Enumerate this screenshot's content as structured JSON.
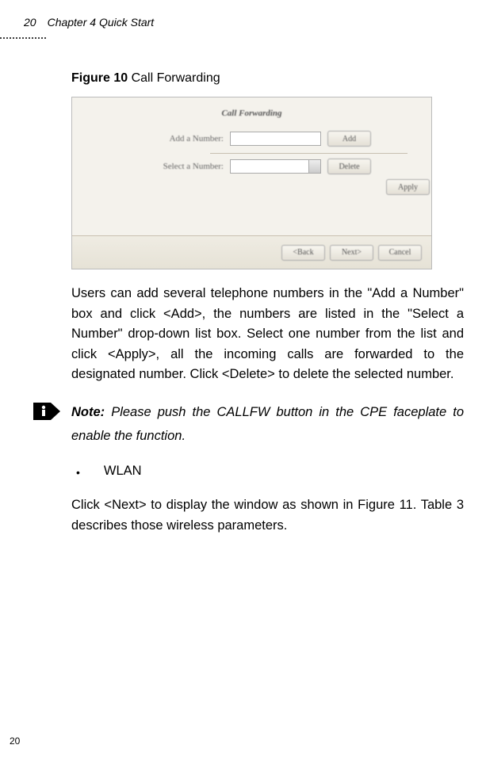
{
  "header": {
    "page_num": "20",
    "chapter": "Chapter 4 Quick Start"
  },
  "figure": {
    "label": "Figure 10",
    "title": "Call Forwarding",
    "dialog_title": "Call Forwarding",
    "labels": {
      "add": "Add a Number:",
      "select": "Select a Number:"
    },
    "buttons": {
      "add": "Add",
      "delete": "Delete",
      "apply": "Apply",
      "back": "<Back",
      "next": "Next>",
      "cancel": "Cancel"
    }
  },
  "body": {
    "paragraph1": "Users can add several telephone numbers in the \"Add a Number\" box and click <Add>, the numbers are listed in the \"Select a Number\" drop-down list box. Select one number from the list and click <Apply>, all the incoming calls are forwarded to the designated number. Click <Delete> to delete the selected number.",
    "note_label": "Note:",
    "note_text": " Please push the CALLFW button in the CPE faceplate to enable the function.",
    "bullet": "WLAN",
    "paragraph2": "Click <Next> to display the window as shown in Figure 11. Table 3 describes those wireless parameters."
  },
  "footer": {
    "page_num": "20"
  }
}
